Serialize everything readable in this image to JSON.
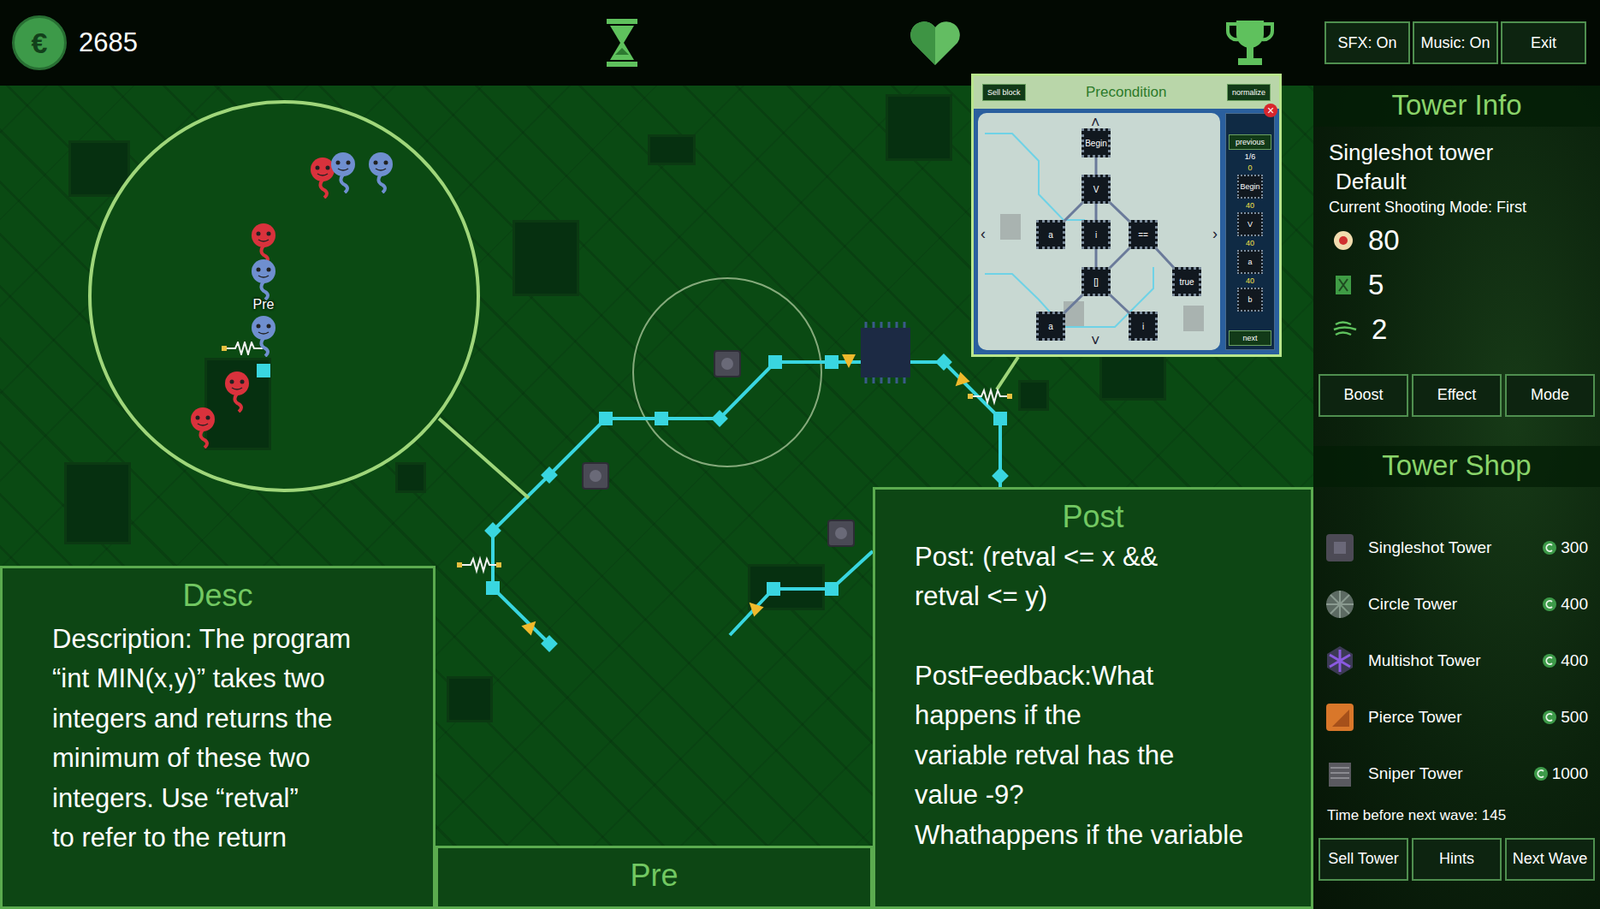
{
  "hud": {
    "coin_symbol": "€",
    "coins": "2685"
  },
  "top_buttons": [
    "SFX: On",
    "Music: On",
    "Exit"
  ],
  "tower_info": {
    "title": "Tower Info",
    "name": "Singleshot tower",
    "variant": "Default",
    "mode": "Current Shooting Mode: First",
    "stats": [
      {
        "kind": "damage",
        "value": "80"
      },
      {
        "kind": "cooldown",
        "value": "5"
      },
      {
        "kind": "speed",
        "value": "2"
      }
    ],
    "buttons": [
      "Boost",
      "Effect",
      "Mode"
    ]
  },
  "tower_shop": {
    "title": "Tower Shop",
    "items": [
      {
        "kind": "singleshot",
        "name": "Singleshot Tower",
        "price": "300"
      },
      {
        "kind": "circle",
        "name": "Circle Tower",
        "price": "400"
      },
      {
        "kind": "multishot",
        "name": "Multishot Tower",
        "price": "400"
      },
      {
        "kind": "pierce",
        "name": "Pierce Tower",
        "price": "500"
      },
      {
        "kind": "sniper",
        "name": "Sniper Tower",
        "price": "1000"
      }
    ],
    "wave_timer": "Time before next wave: 145"
  },
  "bottom_buttons": [
    "Sell Tower",
    "Hints",
    "Next Wave"
  ],
  "desc_panel": {
    "title": "Desc",
    "lines": [
      "Description: The program",
      "“int MIN(x,y)” takes two",
      "integers and returns the",
      "minimum of these two",
      "integers. Use “retval”",
      "to refer to the return"
    ]
  },
  "pre_panel": {
    "title": "Pre"
  },
  "post_panel": {
    "title": "Post",
    "lines": [
      "Post: (retval <= x &&",
      "retval <= y)",
      "",
      "PostFeedback:What",
      "happens if the",
      "variable retval has the",
      "value -9?",
      "Whathappens if the variable"
    ]
  },
  "precondition": {
    "title": "Precondition",
    "sell_button": "Sell block",
    "normalize_button": "normalize",
    "close": "×",
    "arrows": {
      "left": "‹",
      "right": "›",
      "up": "˄",
      "down": "˅"
    },
    "nodes": [
      {
        "label": "Begin"
      },
      {
        "label": "V"
      },
      {
        "label": "a"
      },
      {
        "label": "i"
      },
      {
        "label": "=="
      },
      {
        "label": "[]"
      },
      {
        "label": "true"
      },
      {
        "label": "a"
      },
      {
        "label": "i"
      }
    ],
    "side": {
      "previous": "previous",
      "page": "1/6",
      "items": [
        {
          "kind": "count",
          "text": "0"
        },
        {
          "kind": "chip",
          "text": "Begin"
        },
        {
          "kind": "count",
          "text": "40"
        },
        {
          "kind": "chip",
          "text": "V"
        },
        {
          "kind": "count",
          "text": "40"
        },
        {
          "kind": "chip",
          "text": "a"
        },
        {
          "kind": "count",
          "text": "40"
        },
        {
          "kind": "chip",
          "text": "b"
        }
      ],
      "next": "next"
    }
  },
  "enemies": [
    {
      "color": "#d9323c"
    },
    {
      "color": "#6f8fcf"
    },
    {
      "color": "#6f8fcf"
    },
    {
      "color": "#d9323c"
    },
    {
      "color": "#6f8fcf",
      "label": "Pre"
    },
    {
      "color": "#6f8fcf"
    },
    {
      "color": "#d9323c"
    },
    {
      "color": "#d9323c"
    }
  ]
}
